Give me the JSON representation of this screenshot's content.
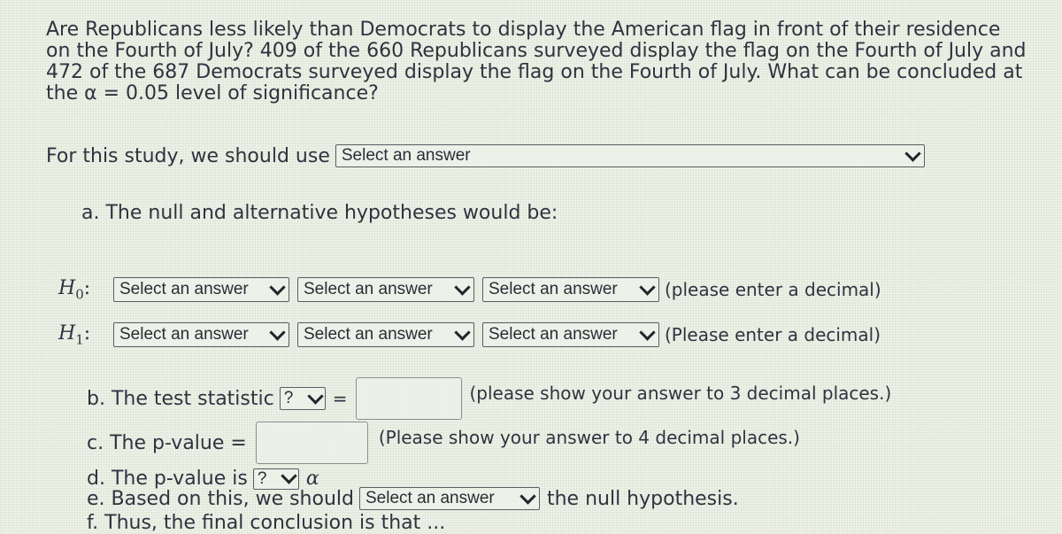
{
  "question": {
    "text": "Are Republicans less likely than Democrats to display the American flag in front of their residence on the Fourth of July? 409 of the 660 Republicans surveyed display the flag on the Fourth of July and 472 of the 687 Democrats surveyed display the flag on the Fourth of July. What can be concluded at the α = 0.05 level of significance?"
  },
  "study": {
    "label": "For this study, we should use",
    "select_value": "Select an answer"
  },
  "part_a": {
    "label": "a. The null and alternative hypotheses would be:",
    "h0": {
      "symbol": "H",
      "sub": "0",
      "colon": ":",
      "selects": [
        "Select an answer",
        "Select an answer",
        "Select an answer"
      ],
      "note": "(please enter a decimal)"
    },
    "h1": {
      "symbol": "H",
      "sub": "1",
      "colon": ":",
      "selects": [
        "Select an answer",
        "Select an answer",
        "Select an answer"
      ],
      "note": "(Please enter a decimal)"
    }
  },
  "part_b": {
    "label": "b. The test statistic",
    "select_value": "?",
    "equals": "=",
    "input_value": "",
    "note": "(please show your answer to 3 decimal places.)"
  },
  "part_c": {
    "label": "c. The p-value =",
    "input_value": "",
    "note": "(Please show your answer to 4 decimal places.)"
  },
  "part_d": {
    "label": "d. The p-value is",
    "select_value": "?",
    "alpha": "α"
  },
  "part_e": {
    "label": "e. Based on this, we should",
    "select_value": "Select an answer",
    "suffix": "the null hypothesis."
  },
  "part_f_partial": {
    "label": "f. Thus, the final conclusion is that ..."
  }
}
